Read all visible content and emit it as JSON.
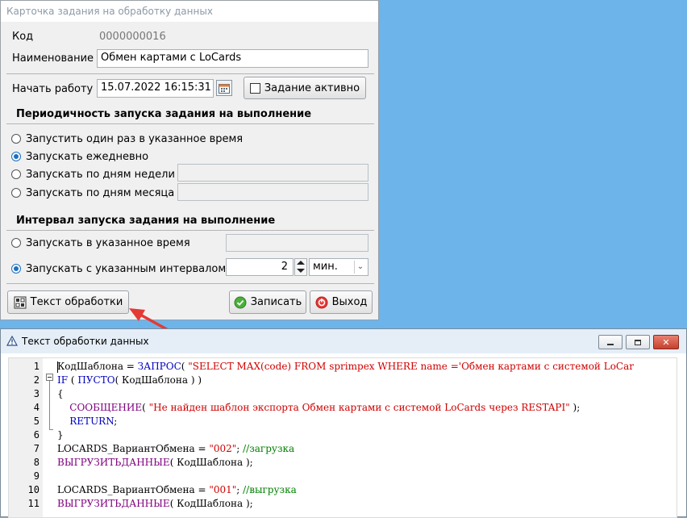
{
  "card_window": {
    "title": "Карточка задания на обработку данных",
    "code_label": "Код",
    "code_value": "0000000016",
    "name_label": "Наименование",
    "name_value": "Обмен картами с LoCards",
    "start_label": "Начать работу",
    "start_value": "15.07.2022 16:15:31",
    "active_label": "Задание активно",
    "active_checked": false,
    "periodicity_section": "Периодичность запуска задания на выполнение",
    "periodicity_options": [
      {
        "label": "Запустить один раз в указанное время",
        "selected": false
      },
      {
        "label": "Запускать ежедневно",
        "selected": true
      },
      {
        "label": "Запускать по дням недели",
        "selected": false
      },
      {
        "label": "Запускать по дням месяца",
        "selected": false
      }
    ],
    "interval_section": "Интервал запуска задания на выполнение",
    "interval_options": [
      {
        "label": "Запускать в указанное время",
        "selected": false
      },
      {
        "label": "Запускать с указанным интервалом",
        "selected": true
      }
    ],
    "interval_value": "2",
    "interval_unit": "мин.",
    "text_button": "Текст обработки",
    "save_button": "Записать",
    "exit_button": "Выход"
  },
  "code_window": {
    "title": "Текст обработки данных",
    "lines": [
      {
        "num": "1",
        "tokens": [
          [
            "t",
            "КодШаблона = "
          ],
          [
            "kw",
            "ЗАПРОС"
          ],
          [
            "t",
            "( "
          ],
          [
            "str",
            "\"SELECT MAX(code) FROM sprimpex WHERE name ='Обмен картами с системой LoCar"
          ]
        ]
      },
      {
        "num": "2",
        "tokens": [
          [
            "kw",
            "IF"
          ],
          [
            "t",
            " ( "
          ],
          [
            "kw",
            "ПУСТО"
          ],
          [
            "t",
            "( КодШаблона ) )"
          ]
        ]
      },
      {
        "num": "3",
        "tokens": [
          [
            "t",
            "{"
          ]
        ]
      },
      {
        "num": "4",
        "tokens": [
          [
            "t",
            "    "
          ],
          [
            "fn",
            "СООБЩЕНИЕ"
          ],
          [
            "t",
            "( "
          ],
          [
            "str",
            "\"Не найден шаблон экспорта Обмен картами с системой LoCards через RESTAPI\""
          ],
          [
            "t",
            " );"
          ]
        ]
      },
      {
        "num": "5",
        "tokens": [
          [
            "t",
            "    "
          ],
          [
            "kw",
            "RETURN"
          ],
          [
            "t",
            ";"
          ]
        ]
      },
      {
        "num": "6",
        "tokens": [
          [
            "t",
            "}"
          ]
        ]
      },
      {
        "num": "7",
        "tokens": [
          [
            "t",
            "LOCARDS_ВариантОбмена = "
          ],
          [
            "str",
            "\"002\""
          ],
          [
            "t",
            "; "
          ],
          [
            "cm",
            "//загрузка"
          ]
        ]
      },
      {
        "num": "8",
        "tokens": [
          [
            "fn",
            "ВЫГРУЗИТЬДАННЫЕ"
          ],
          [
            "t",
            "( КодШаблона );"
          ]
        ]
      },
      {
        "num": "9",
        "tokens": []
      },
      {
        "num": "10",
        "tokens": [
          [
            "t",
            "LOCARDS_ВариантОбмена = "
          ],
          [
            "str",
            "\"001\""
          ],
          [
            "t",
            "; "
          ],
          [
            "cm",
            "//выгрузка"
          ]
        ]
      },
      {
        "num": "11",
        "tokens": [
          [
            "fn",
            "ВЫГРУЗИТЬДАННЫЕ"
          ],
          [
            "t",
            "( КодШаблона );"
          ]
        ]
      }
    ]
  },
  "colors": {
    "background": "#6cb4ea",
    "annotation_arrow": "#e53935",
    "keyword": "#0000c0",
    "function": "#800080",
    "string": "#d00000",
    "comment": "#008000"
  }
}
